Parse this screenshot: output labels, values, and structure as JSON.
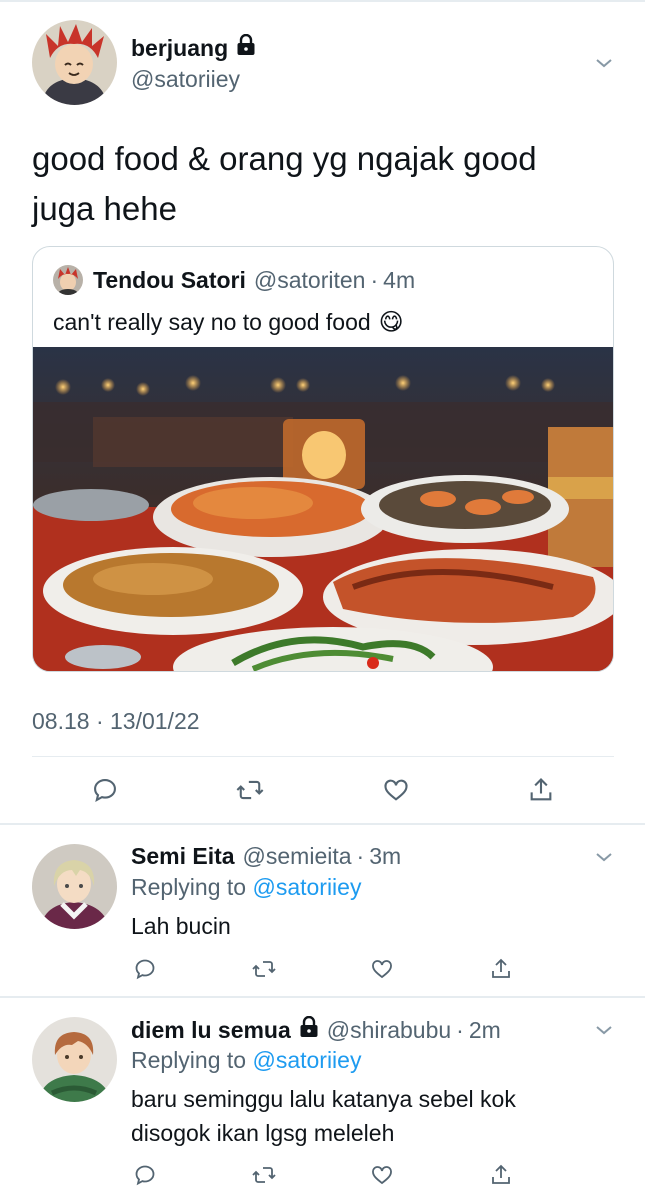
{
  "main_tweet": {
    "display_name": "berjuang",
    "handle": "@satoriiey",
    "text": "good food & orang yg ngajak good juga hehe",
    "timestamp": "08.18 · 13/01/22",
    "icons": {
      "lock": "lock-icon",
      "menu": "chevron-down-icon"
    }
  },
  "quoted_tweet": {
    "display_name": "Tendou Satori",
    "handle": "@satoriten",
    "time": "4m",
    "text": "can't really say no to good food",
    "emoji": "😋",
    "image_alt": "seafood dinner photo"
  },
  "action_icons": [
    "reply-icon",
    "retweet-icon",
    "like-icon",
    "share-icon"
  ],
  "replies": [
    {
      "display_name": "Semi Eita",
      "handle": "@semieita",
      "time": "3m",
      "replying_prefix": "Replying to",
      "replying_to": "@satoriiey",
      "text": "Lah bucin",
      "locked": false
    },
    {
      "display_name": "diem lu semua",
      "handle": "@shirabubu",
      "time": "2m",
      "replying_prefix": "Replying to",
      "replying_to": "@satoriiey",
      "text": "baru seminggu lalu katanya sebel kok disogok ikan lgsg meleleh",
      "locked": true
    }
  ],
  "colors": {
    "text": "#0f1419",
    "secondary": "#536471",
    "link": "#1d9bf0",
    "border": "#cfd9de"
  }
}
